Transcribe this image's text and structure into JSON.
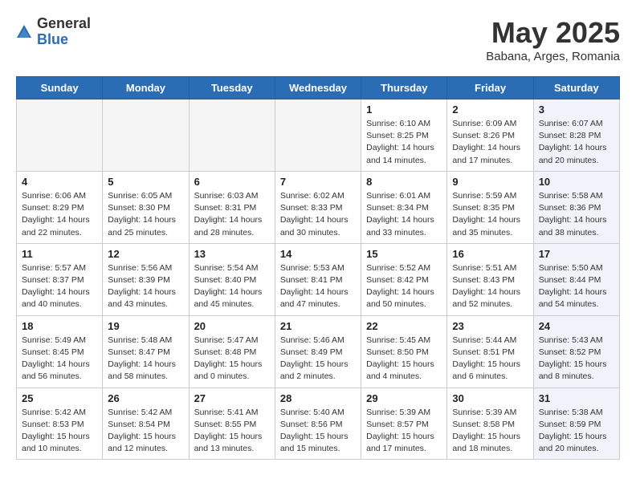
{
  "header": {
    "logo_general": "General",
    "logo_blue": "Blue",
    "month": "May 2025",
    "location": "Babana, Arges, Romania"
  },
  "weekdays": [
    "Sunday",
    "Monday",
    "Tuesday",
    "Wednesday",
    "Thursday",
    "Friday",
    "Saturday"
  ],
  "weeks": [
    [
      {
        "day": "",
        "info": ""
      },
      {
        "day": "",
        "info": ""
      },
      {
        "day": "",
        "info": ""
      },
      {
        "day": "",
        "info": ""
      },
      {
        "day": "1",
        "info": "Sunrise: 6:10 AM\nSunset: 8:25 PM\nDaylight: 14 hours\nand 14 minutes."
      },
      {
        "day": "2",
        "info": "Sunrise: 6:09 AM\nSunset: 8:26 PM\nDaylight: 14 hours\nand 17 minutes."
      },
      {
        "day": "3",
        "info": "Sunrise: 6:07 AM\nSunset: 8:28 PM\nDaylight: 14 hours\nand 20 minutes."
      }
    ],
    [
      {
        "day": "4",
        "info": "Sunrise: 6:06 AM\nSunset: 8:29 PM\nDaylight: 14 hours\nand 22 minutes."
      },
      {
        "day": "5",
        "info": "Sunrise: 6:05 AM\nSunset: 8:30 PM\nDaylight: 14 hours\nand 25 minutes."
      },
      {
        "day": "6",
        "info": "Sunrise: 6:03 AM\nSunset: 8:31 PM\nDaylight: 14 hours\nand 28 minutes."
      },
      {
        "day": "7",
        "info": "Sunrise: 6:02 AM\nSunset: 8:33 PM\nDaylight: 14 hours\nand 30 minutes."
      },
      {
        "day": "8",
        "info": "Sunrise: 6:01 AM\nSunset: 8:34 PM\nDaylight: 14 hours\nand 33 minutes."
      },
      {
        "day": "9",
        "info": "Sunrise: 5:59 AM\nSunset: 8:35 PM\nDaylight: 14 hours\nand 35 minutes."
      },
      {
        "day": "10",
        "info": "Sunrise: 5:58 AM\nSunset: 8:36 PM\nDaylight: 14 hours\nand 38 minutes."
      }
    ],
    [
      {
        "day": "11",
        "info": "Sunrise: 5:57 AM\nSunset: 8:37 PM\nDaylight: 14 hours\nand 40 minutes."
      },
      {
        "day": "12",
        "info": "Sunrise: 5:56 AM\nSunset: 8:39 PM\nDaylight: 14 hours\nand 43 minutes."
      },
      {
        "day": "13",
        "info": "Sunrise: 5:54 AM\nSunset: 8:40 PM\nDaylight: 14 hours\nand 45 minutes."
      },
      {
        "day": "14",
        "info": "Sunrise: 5:53 AM\nSunset: 8:41 PM\nDaylight: 14 hours\nand 47 minutes."
      },
      {
        "day": "15",
        "info": "Sunrise: 5:52 AM\nSunset: 8:42 PM\nDaylight: 14 hours\nand 50 minutes."
      },
      {
        "day": "16",
        "info": "Sunrise: 5:51 AM\nSunset: 8:43 PM\nDaylight: 14 hours\nand 52 minutes."
      },
      {
        "day": "17",
        "info": "Sunrise: 5:50 AM\nSunset: 8:44 PM\nDaylight: 14 hours\nand 54 minutes."
      }
    ],
    [
      {
        "day": "18",
        "info": "Sunrise: 5:49 AM\nSunset: 8:45 PM\nDaylight: 14 hours\nand 56 minutes."
      },
      {
        "day": "19",
        "info": "Sunrise: 5:48 AM\nSunset: 8:47 PM\nDaylight: 14 hours\nand 58 minutes."
      },
      {
        "day": "20",
        "info": "Sunrise: 5:47 AM\nSunset: 8:48 PM\nDaylight: 15 hours\nand 0 minutes."
      },
      {
        "day": "21",
        "info": "Sunrise: 5:46 AM\nSunset: 8:49 PM\nDaylight: 15 hours\nand 2 minutes."
      },
      {
        "day": "22",
        "info": "Sunrise: 5:45 AM\nSunset: 8:50 PM\nDaylight: 15 hours\nand 4 minutes."
      },
      {
        "day": "23",
        "info": "Sunrise: 5:44 AM\nSunset: 8:51 PM\nDaylight: 15 hours\nand 6 minutes."
      },
      {
        "day": "24",
        "info": "Sunrise: 5:43 AM\nSunset: 8:52 PM\nDaylight: 15 hours\nand 8 minutes."
      }
    ],
    [
      {
        "day": "25",
        "info": "Sunrise: 5:42 AM\nSunset: 8:53 PM\nDaylight: 15 hours\nand 10 minutes."
      },
      {
        "day": "26",
        "info": "Sunrise: 5:42 AM\nSunset: 8:54 PM\nDaylight: 15 hours\nand 12 minutes."
      },
      {
        "day": "27",
        "info": "Sunrise: 5:41 AM\nSunset: 8:55 PM\nDaylight: 15 hours\nand 13 minutes."
      },
      {
        "day": "28",
        "info": "Sunrise: 5:40 AM\nSunset: 8:56 PM\nDaylight: 15 hours\nand 15 minutes."
      },
      {
        "day": "29",
        "info": "Sunrise: 5:39 AM\nSunset: 8:57 PM\nDaylight: 15 hours\nand 17 minutes."
      },
      {
        "day": "30",
        "info": "Sunrise: 5:39 AM\nSunset: 8:58 PM\nDaylight: 15 hours\nand 18 minutes."
      },
      {
        "day": "31",
        "info": "Sunrise: 5:38 AM\nSunset: 8:59 PM\nDaylight: 15 hours\nand 20 minutes."
      }
    ]
  ]
}
